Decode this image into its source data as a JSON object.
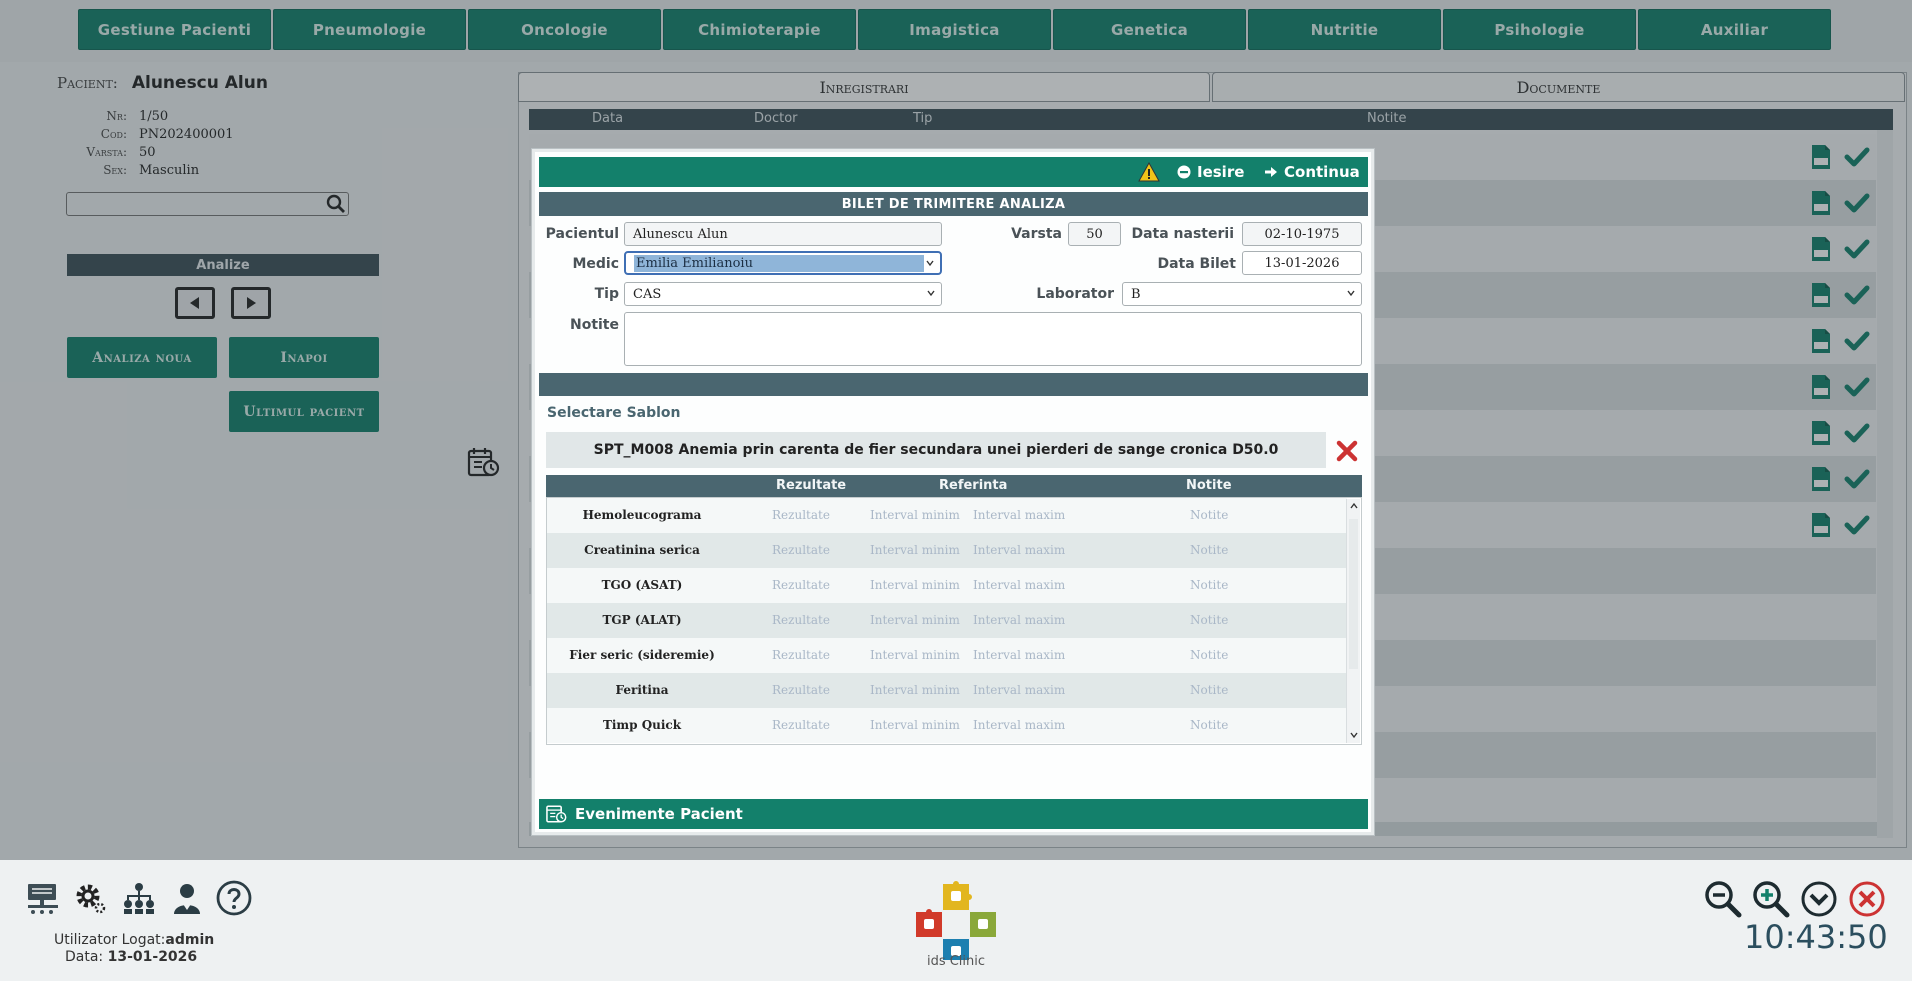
{
  "nav": {
    "items": [
      "Gestiune Pacienti",
      "Pneumologie",
      "Oncologie",
      "Chimioterapie",
      "Imagistica",
      "Genetica",
      "Nutritie",
      "Psihologie",
      "Auxiliar"
    ]
  },
  "patient": {
    "title_key": "Pacient:",
    "name": "Alunescu Alun",
    "fields": [
      {
        "k": "Nr:",
        "v": "1/50"
      },
      {
        "k": "Cod:",
        "v": "PN202400001"
      },
      {
        "k": "Varsta:",
        "v": "50"
      },
      {
        "k": "Sex:",
        "v": "Masculin"
      }
    ]
  },
  "left": {
    "search_placeholder": "",
    "analize_label": "Analize",
    "new_analysis": "Analiza noua",
    "back": "Inapoi",
    "last_patient": "Ultimul pacient"
  },
  "tabs": {
    "records": "Inregistrari",
    "documents": "Documente"
  },
  "records_table": {
    "columns": [
      "Data",
      "Doctor",
      "Tip",
      "Notite"
    ]
  },
  "modal": {
    "exit": "Iesire",
    "continue": "Continua",
    "subtitle": "BILET DE TRIMITERE ANALIZA",
    "labels": {
      "patient": "Pacientul",
      "age": "Varsta",
      "birth": "Data nasterii",
      "medic": "Medic",
      "ticket_date": "Data Bilet",
      "type": "Tip",
      "lab": "Laborator",
      "notes": "Notite"
    },
    "values": {
      "patient": "Alunescu Alun",
      "age": "50",
      "birth": "02-10-1975",
      "medic": "Emilia Emilianoiu",
      "ticket_date": "13-01-2026",
      "type": "CAS",
      "lab": "B",
      "notes": ""
    },
    "template_label": "Selectare Sablon",
    "template_value": "SPT_M008 Anemia prin carenta de fier secundara unei pierderi de sange cronica D50.0",
    "table_headers": {
      "results": "Rezultate",
      "reference": "Referinta",
      "notes": "Notite"
    },
    "placeholders": {
      "results": "Rezultate",
      "min": "Interval minim",
      "max": "Interval maxim",
      "notes": "Notite"
    },
    "tests": [
      "Hemoleucograma",
      "Creatinina serica",
      "TGO (ASAT)",
      "TGP (ALAT)",
      "Fier seric (sideremie)",
      "Feritina",
      "Timp Quick"
    ],
    "footer": "Evenimente Pacient"
  },
  "footer": {
    "user_label": "Utilizator Logat:",
    "user": "admin",
    "date_label": "Data:",
    "date": "13-01-2026",
    "clock": "10:43:50",
    "logo_text": "ids Clinic"
  },
  "colors": {
    "accent": "#13806b",
    "header": "#3d5058",
    "danger": "#cc3333"
  }
}
